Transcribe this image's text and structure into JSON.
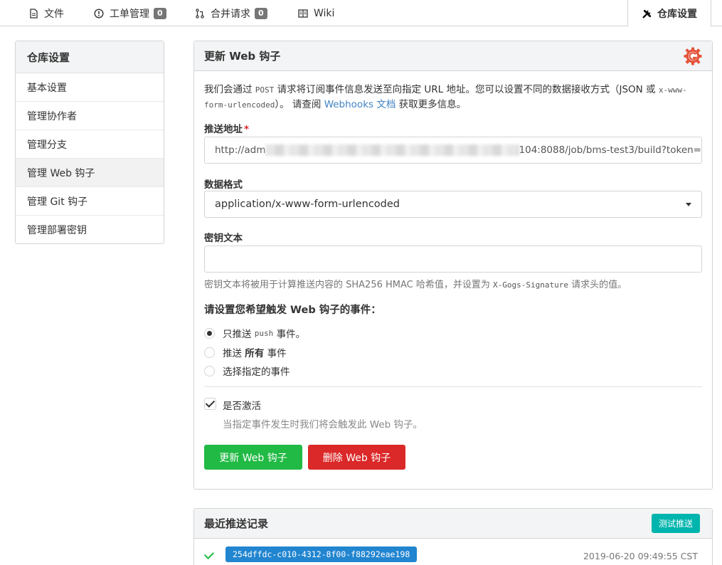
{
  "tabs": [
    {
      "label": "文件",
      "icon": "file-icon"
    },
    {
      "label": "工单管理",
      "icon": "issue-icon",
      "badge": "0"
    },
    {
      "label": "合并请求",
      "icon": "pull-request-icon",
      "badge": "0"
    },
    {
      "label": "Wiki",
      "icon": "book-icon"
    },
    {
      "label": "仓库设置",
      "icon": "tools-icon",
      "active": true
    }
  ],
  "sidebar": {
    "title": "仓库设置",
    "items": [
      {
        "label": "基本设置"
      },
      {
        "label": "管理协作者"
      },
      {
        "label": "管理分支"
      },
      {
        "label": "管理 Web 钩子",
        "active": true
      },
      {
        "label": "管理 Git 钩子"
      },
      {
        "label": "管理部署密钥"
      }
    ]
  },
  "form": {
    "title": "更新 Web 钩子",
    "desc_pre": "我们会通过",
    "desc_method": "POST",
    "desc_mid": "请求将订阅事件信息发送至向指定 URL 地址。您可以设置不同的数据接收方式（JSON 或",
    "desc_format": "x-www-form-urlencoded",
    "desc_post": "）。 请查阅",
    "desc_link": "Webhooks 文档",
    "desc_end": "获取更多信息。",
    "url_label": "推送地址",
    "url_value_prefix": "http://adm",
    "url_value_suffix": "104:8088/job/bms-test3/build?token=",
    "content_type_label": "数据格式",
    "content_type_value": "application/x-www-form-urlencoded",
    "secret_label": "密钥文本",
    "secret_value": "",
    "secret_help_pre": "密钥文本将被用于计算推送内容的 SHA256 HMAC 哈希值，并设置为",
    "secret_help_header": "X-Gogs-Signature",
    "secret_help_post": "请求头的值。",
    "events_title": "请设置您希望触发 Web 钩子的事件：",
    "event_push_pre": "只推送",
    "event_push_code": "push",
    "event_push_post": "事件。",
    "event_all_pre": "推送",
    "event_all_bold": "所有",
    "event_all_post": "事件",
    "event_choose": "选择指定的事件",
    "active_label": "是否激活",
    "active_help": "当指定事件发生时我们将会触发此 Web 钩子。",
    "update_button": "更新 Web 钩子",
    "delete_button": "删除 Web 钩子",
    "colors": {
      "green": "#21ba45",
      "red": "#db2828",
      "teal": "#00b5ad",
      "blue": "#2185d0"
    }
  },
  "deliveries": {
    "title": "最近推送记录",
    "test_button": "测试推送",
    "items": [
      {
        "uuid": "254dffdc-c010-4312-8f00-f88292eae198",
        "time": "2019-06-20 09:49:55 CST",
        "status": "success"
      }
    ]
  }
}
